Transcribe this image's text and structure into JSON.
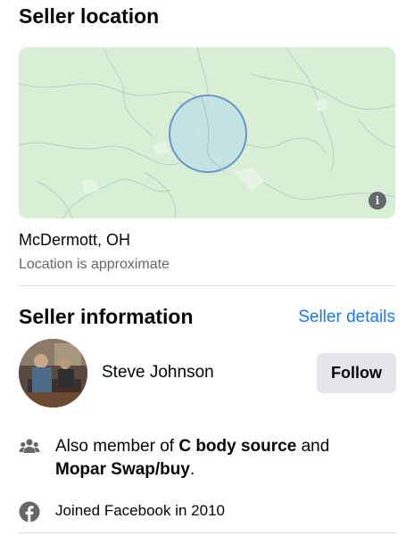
{
  "location_section": {
    "title": "Seller location",
    "city": "McDermott, OH",
    "note": "Location is approximate"
  },
  "seller_section": {
    "title": "Seller information",
    "details_link": "Seller details",
    "seller_name": "Steve Johnson",
    "follow_label": "Follow",
    "membership": {
      "prefix": "Also member of ",
      "group1": "C body source",
      "middle": " and ",
      "group2": "Mopar Swap/buy",
      "suffix": "."
    },
    "joined": "Joined Facebook in 2010"
  },
  "icons": {
    "map_info": "info-icon",
    "groups": "groups-icon",
    "facebook": "facebook-icon"
  },
  "colors": {
    "link": "#1877f2",
    "map_land": "#d8efd6",
    "radius_fill": "#bfe0e6",
    "radius_stroke": "#6b95c9",
    "secondary_text": "#65676b",
    "button_bg": "#e4e6eb"
  }
}
